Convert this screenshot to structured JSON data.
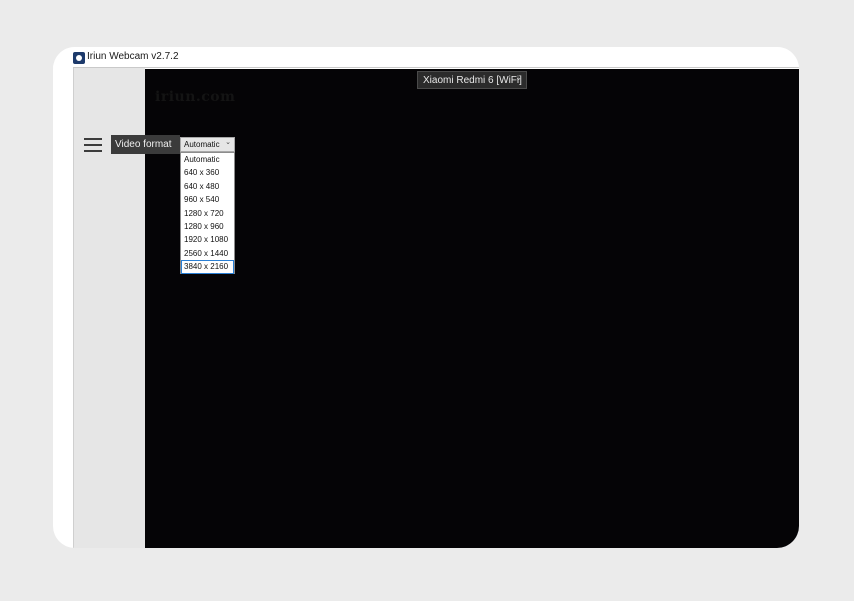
{
  "window": {
    "title": "Iriun Webcam v2.7.2"
  },
  "preview": {
    "watermark": "iriun.com",
    "device_select": {
      "value": "Xiaomi Redmi 6 [WiFi]"
    }
  },
  "settings": {
    "video_format_label": "Video format",
    "video_format_select": {
      "value": "Automatic",
      "options": [
        "Automatic",
        "640 x 360",
        "640 x 480",
        "960 x 540",
        "1280 x 720",
        "1280 x 960",
        "1920 x 1080",
        "2560 x 1440",
        "3840 x 2160"
      ],
      "highlighted_option": "3840 x 2160"
    }
  },
  "icons": {
    "app": "iriun-app-icon",
    "menu": "hamburger-menu-icon",
    "dropdown": "chevron-down-icon"
  },
  "colors": {
    "preview_background": "#050406",
    "sidebar_background": "#e6e6e6",
    "label_background": "#3b3b3b",
    "selection_border": "#2a7fd4"
  }
}
